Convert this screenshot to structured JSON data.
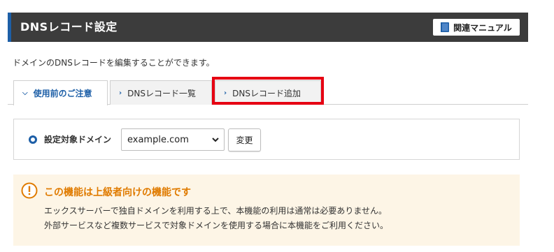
{
  "header": {
    "title": "DNSレコード設定",
    "manual_button": "関連マニュアル"
  },
  "description": "ドメインのDNSレコードを編集することができます。",
  "tabs": [
    {
      "label": "使用前のご注意",
      "active": true,
      "icon": "chevron-down-icon"
    },
    {
      "label": "DNSレコード一覧",
      "active": false,
      "icon": "chevron-right-icon"
    },
    {
      "label": "DNSレコード追加",
      "active": false,
      "icon": "chevron-right-icon"
    }
  ],
  "domain_selector": {
    "label": "設定対象ドメイン",
    "selected_value": "example.com",
    "change_button": "変更"
  },
  "notice": {
    "icon": "warning-circle-icon",
    "title": "この機能は上級者向けの機能です",
    "lines": [
      "エックスサーバーで独自ドメインを利用する上で、本機能の利用は通常は必要ありません。",
      "外部サービスなど複数サービスで対象ドメインを使用する場合に本機能をご利用ください。"
    ]
  },
  "colors": {
    "header_bg": "#3c3c3c",
    "accent_blue": "#1d5fa7",
    "highlight_red": "#e60012",
    "notice_bg": "#fdf5e6",
    "notice_title": "#e07b00"
  }
}
